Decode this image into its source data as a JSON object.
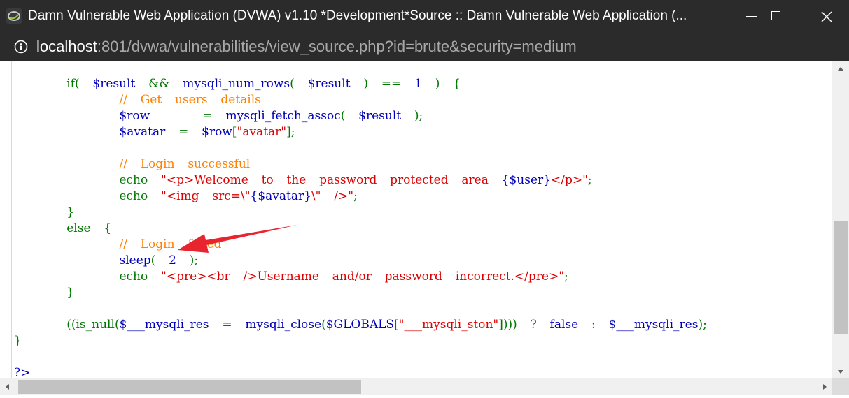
{
  "window": {
    "title": "Damn Vulnerable Web Application (DVWA) v1.10 *Development*Source :: Damn Vulnerable Web Application (...",
    "icon": "dvwa-app-icon",
    "controls": [
      "minimize-icon",
      "maximize-icon",
      "close-icon"
    ]
  },
  "address": {
    "host": "localhost",
    "rest": ":801/dvwa/vulnerabilities/view_source.php?id=brute&security=medium",
    "icon": "info-icon"
  },
  "code_lines": [
    "        if(  $result  &&  mysqli_num_rows(  $result  )  ==  1  )  {",
    "                //  Get  users  details",
    "                $row        =  mysqli_fetch_assoc(  $result  );",
    "                $avatar  =  $row[\"avatar\"];",
    "",
    "                //  Login  successful",
    "                echo  \"<p>Welcome  to  the  password  protected  area  {$user}</p>\";",
    "                echo  \"<img  src=\\\"{$avatar}\\\"  />\";",
    "        }",
    "        else  {",
    "                //  Login  failed",
    "                sleep(  2  );",
    "                echo  \"<pre><br  />Username  and/or  password  incorrect.</pre>\";",
    "        }",
    "",
    "        ((is_null($___mysqli_res  =  mysqli_close($GLOBALS[\"___mysqli_ston\"])))  ?  false  :  $___mysqli_res);",
    "}",
    "",
    "?>"
  ],
  "colors": {
    "keyword": "#007700",
    "variable": "#0000BB",
    "comment": "#FF8000",
    "string": "#DD0000",
    "arrow": "#e8242f",
    "chrome": "#2b2b2b"
  }
}
